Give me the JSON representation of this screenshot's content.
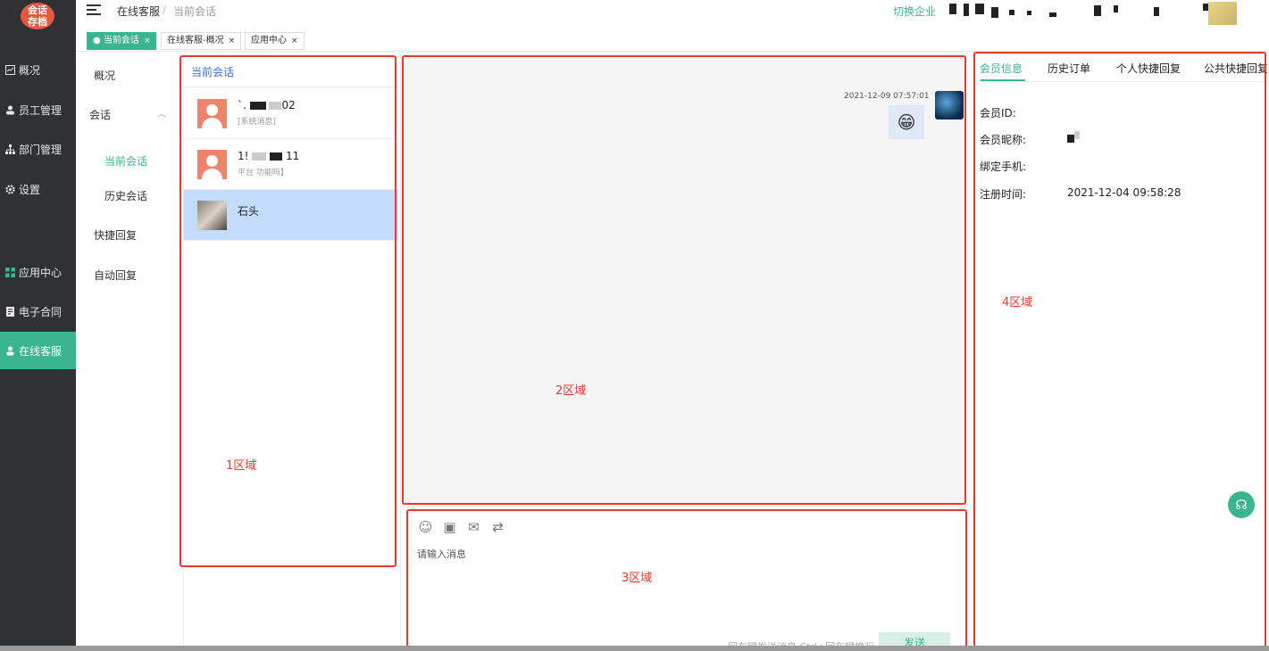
{
  "logo": {
    "line1": "会话",
    "line2": "存档"
  },
  "nav": {
    "items": [
      {
        "label": "概况",
        "icon": "chart-icon"
      },
      {
        "label": "员工管理",
        "icon": "users-icon"
      },
      {
        "label": "部门管理",
        "icon": "org-icon"
      },
      {
        "label": "设置",
        "icon": "gear-icon"
      },
      {
        "label": "应用中心",
        "icon": "grid-icon"
      },
      {
        "label": "电子合同",
        "icon": "document-icon"
      },
      {
        "label": "在线客服",
        "icon": "person-icon"
      }
    ],
    "active": "在线客服"
  },
  "header": {
    "breadcrumb": [
      "在线客服",
      "当前会话"
    ],
    "separator": "/",
    "switch_enterprise": "切换企业"
  },
  "tabs": [
    {
      "label": "当前会话",
      "close": "×",
      "active": true
    },
    {
      "label": "在线客服-概况",
      "close": "×"
    },
    {
      "label": "应用中心",
      "close": "×"
    }
  ],
  "submenu": {
    "overview": "概况",
    "session": "会话",
    "current_session": "当前会话",
    "history_session": "历史会话",
    "quick_reply": "快捷回复",
    "auto_reply": "自动回复"
  },
  "conversation_list": {
    "title": "当前会话",
    "items": [
      {
        "name_prefix": "`.",
        "name_suffix": "02",
        "preview": "[系统消息]"
      },
      {
        "name_prefix": "1!",
        "name_suffix": "11",
        "preview": "平台 功能吗】"
      },
      {
        "name": "石头",
        "preview": "",
        "selected": true
      }
    ]
  },
  "chat": {
    "message_time": "2021-12-09 07:57:01",
    "message_content": "😁"
  },
  "composer": {
    "placeholder": "请输入消息",
    "hint": "回车键发送消息 Ctrl+回车键换行",
    "send_label": "发送",
    "tools": [
      "smile-icon",
      "image-icon",
      "mail-icon",
      "swap-icon"
    ]
  },
  "member_panel": {
    "tabs": [
      "会员信息",
      "历史订单",
      "个人快捷回复",
      "公共快捷回复"
    ],
    "fields": [
      {
        "label": "会员ID:",
        "value": ""
      },
      {
        "label": "会员昵称:",
        "value": ""
      },
      {
        "label": "绑定手机:",
        "value": ""
      },
      {
        "label": "注册时间:",
        "value": "2021-12-04 09:58:28"
      }
    ]
  },
  "zones": {
    "z1": "1区域",
    "z2": "2区域",
    "z3": "3区域",
    "z4": "4区域"
  },
  "colors": {
    "accent": "#3ab68f",
    "annotation": "#e8392d",
    "selected_row": "#c3dcfb",
    "sidebar": "#2f3135"
  }
}
